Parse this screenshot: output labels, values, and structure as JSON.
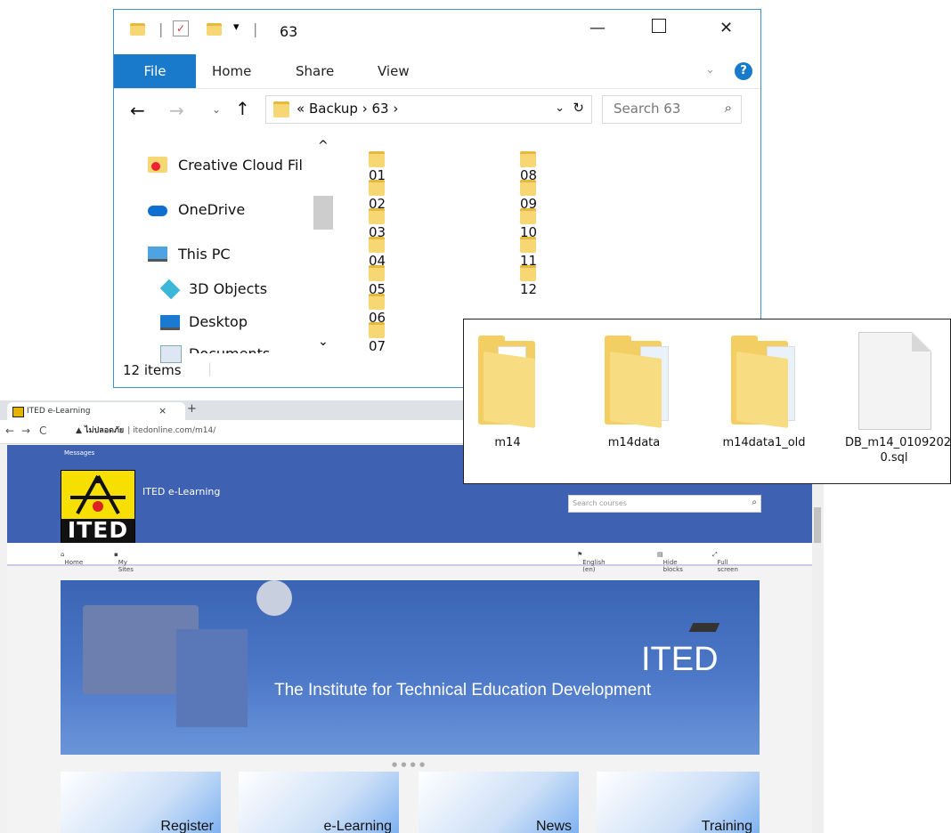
{
  "explorer": {
    "title": "63",
    "ribbon_tabs": [
      "File",
      "Home",
      "Share",
      "View"
    ],
    "path": [
      "«",
      "Backup",
      "›",
      "63",
      "›"
    ],
    "search_placeholder": "Search 63",
    "nav": [
      {
        "label": "Creative Cloud Fil",
        "icon": "creative-cloud-icon"
      },
      {
        "label": "OneDrive",
        "icon": "onedrive-cloud-icon"
      },
      {
        "label": "This PC",
        "icon": "computer-icon"
      },
      {
        "label": "3D Objects",
        "icon": "cube-icon"
      },
      {
        "label": "Desktop",
        "icon": "desktop-icon"
      },
      {
        "label": "Documents",
        "icon": "documents-icon"
      }
    ],
    "folders": [
      "01",
      "02",
      "03",
      "04",
      "05",
      "06",
      "07",
      "08",
      "09",
      "10",
      "11",
      "12"
    ],
    "status": "12 items"
  },
  "drag_items": [
    {
      "label": "m14",
      "icon": "folder-icon"
    },
    {
      "label": "m14data",
      "icon": "folder-icon"
    },
    {
      "label": "m14data1_old",
      "icon": "folder-icon"
    },
    {
      "label": "DB_m14_01092020.sql",
      "label_lines": [
        "DB_m14_0109202",
        "0.sql"
      ],
      "icon": "file-icon"
    }
  ],
  "browser": {
    "tab_title": "ITED e-Learning",
    "tab_close": "×",
    "new_tab": "+",
    "url_warning": "▲ ไม่ปลอดภัย",
    "url": "itedonline.com/m14/",
    "messages": "Messages",
    "site_name": "ITED e-Learning",
    "logo_text": "ITED",
    "course_search_placeholder": "Search courses",
    "nav_left": [
      "Home",
      "My Sites"
    ],
    "nav_right": [
      "English (en)",
      "Hide blocks",
      "Full screen"
    ],
    "banner_title": "ITED",
    "banner_subtitle": "The Institute for Technical Education Development",
    "tiles": [
      "Register",
      "e-Learning",
      "News",
      "Training"
    ]
  },
  "colors": {
    "explorer_accent": "#1979ca",
    "site_header": "#3e61b1",
    "folder": "#f7d674"
  }
}
